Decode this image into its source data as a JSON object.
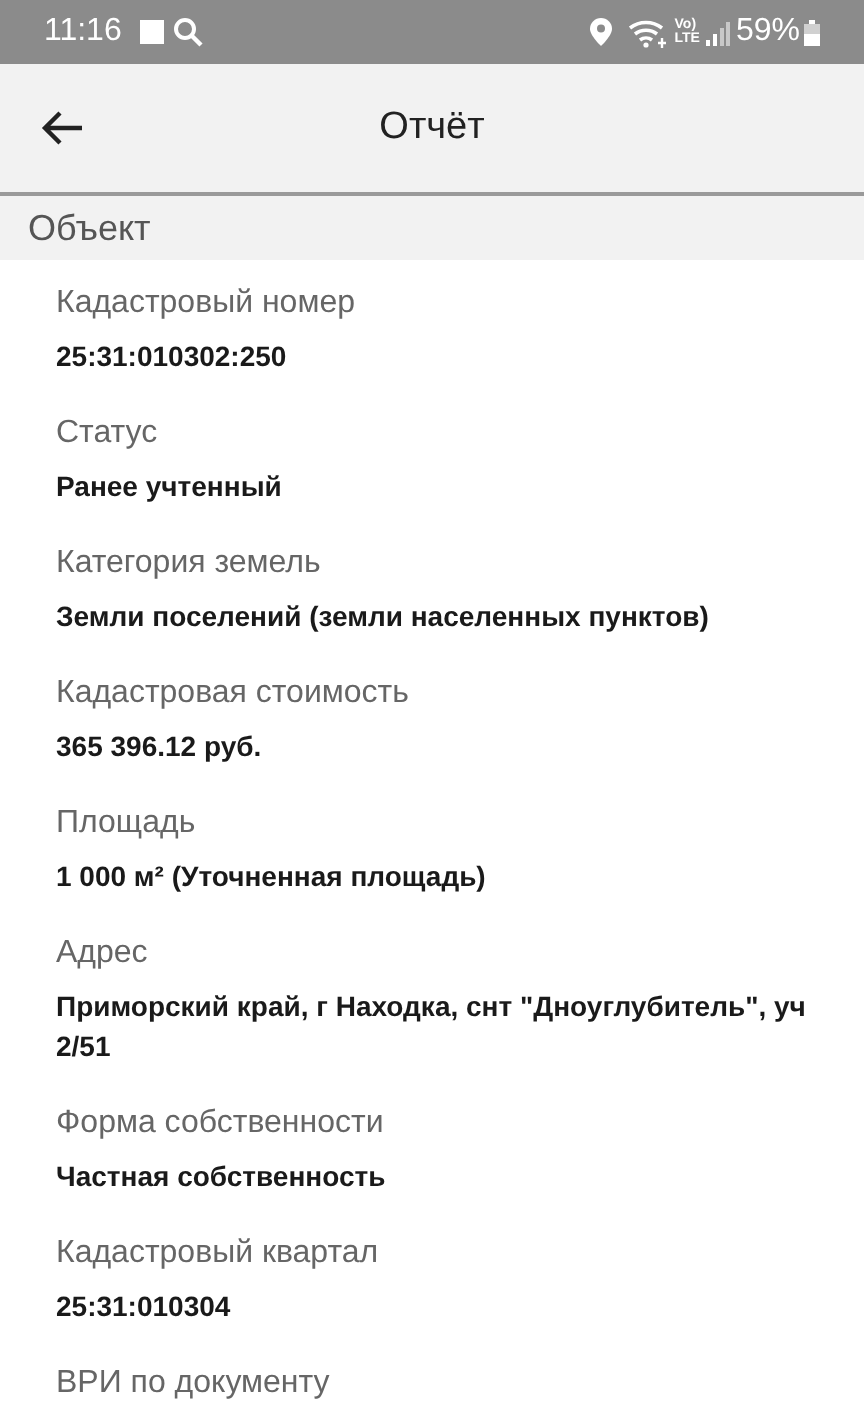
{
  "status_bar": {
    "time": "11:16",
    "network_badge": [
      "Vo)",
      "LTE"
    ],
    "battery": "59%"
  },
  "app_bar": {
    "title": "Отчёт"
  },
  "section": {
    "title": "Объект"
  },
  "fields": [
    {
      "label": "Кадастровый номер",
      "value": "25:31:010302:250"
    },
    {
      "label": "Статус",
      "value": "Ранее учтенный"
    },
    {
      "label": "Категория земель",
      "value": "Земли поселений (земли населенных пунктов)"
    },
    {
      "label": "Кадастровая стоимость",
      "value": "365 396.12 руб."
    },
    {
      "label": "Площадь",
      "value": "1 000 м² (Уточненная площадь)"
    },
    {
      "label": "Адрес",
      "value": "Приморский край, г Находка, снт \"Дноуглубитель\", уч 2/51"
    },
    {
      "label": "Форма собственности",
      "value": "Частная собственность"
    },
    {
      "label": "Кадастровый квартал",
      "value": "25:31:010304"
    },
    {
      "label": "ВРИ по документу"
    }
  ]
}
